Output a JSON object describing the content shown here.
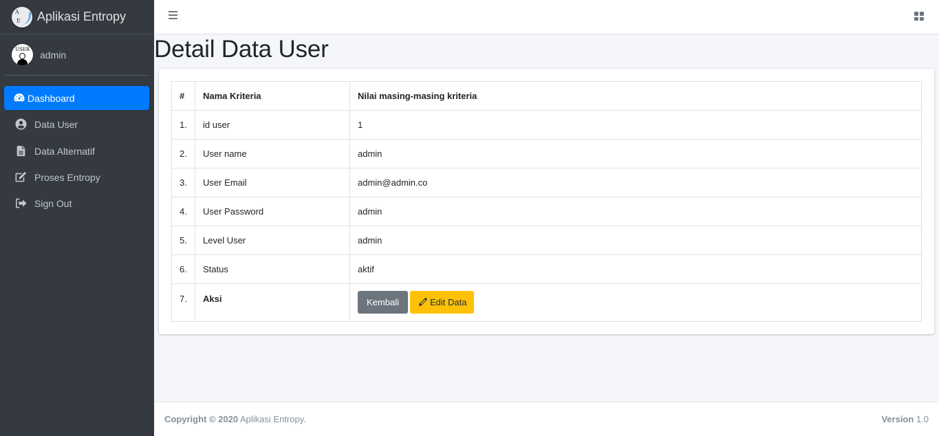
{
  "brand": {
    "title": "Aplikasi Entropy",
    "logo_letter_top": "A",
    "logo_letter_bottom": "E"
  },
  "user": {
    "name": "admin",
    "avatar_text": "USER"
  },
  "sidebar": {
    "items": [
      {
        "label": "Dashboard",
        "icon": "tachometer-icon",
        "active": true
      },
      {
        "label": "Data User",
        "icon": "user-circle-icon"
      },
      {
        "label": "Data Alternatif",
        "icon": "file-alt-icon"
      },
      {
        "label": "Proses Entropy",
        "icon": "edit-icon"
      },
      {
        "label": "Sign Out",
        "icon": "sign-out-icon"
      }
    ]
  },
  "page": {
    "title": "Detail Data User"
  },
  "table": {
    "headers": [
      "#",
      "Nama Kriteria",
      "Nilai masing-masing kriteria"
    ],
    "rows": [
      {
        "num": "1.",
        "name": "id user",
        "value": "1"
      },
      {
        "num": "2.",
        "name": "User name",
        "value": "admin"
      },
      {
        "num": "3.",
        "name": "User Email",
        "value": "admin@admin.co"
      },
      {
        "num": "4.",
        "name": "User Password",
        "value": "admin"
      },
      {
        "num": "5.",
        "name": "Level User",
        "value": "admin"
      },
      {
        "num": "6.",
        "name": "Status",
        "value": "aktif"
      }
    ],
    "action_row": {
      "num": "7.",
      "name": "Aksi"
    }
  },
  "actions": {
    "back_label": "Kembali",
    "edit_label": "Edit Data"
  },
  "footer": {
    "copyright_bold": "Copyright © 2020",
    "copyright_app": " Aplikasi Entropy.",
    "version_label": "Version",
    "version_value": " 1.0"
  },
  "colors": {
    "sidebar_bg": "#343a40",
    "active": "#007bff",
    "warning": "#ffc107",
    "secondary": "#6c757d"
  }
}
